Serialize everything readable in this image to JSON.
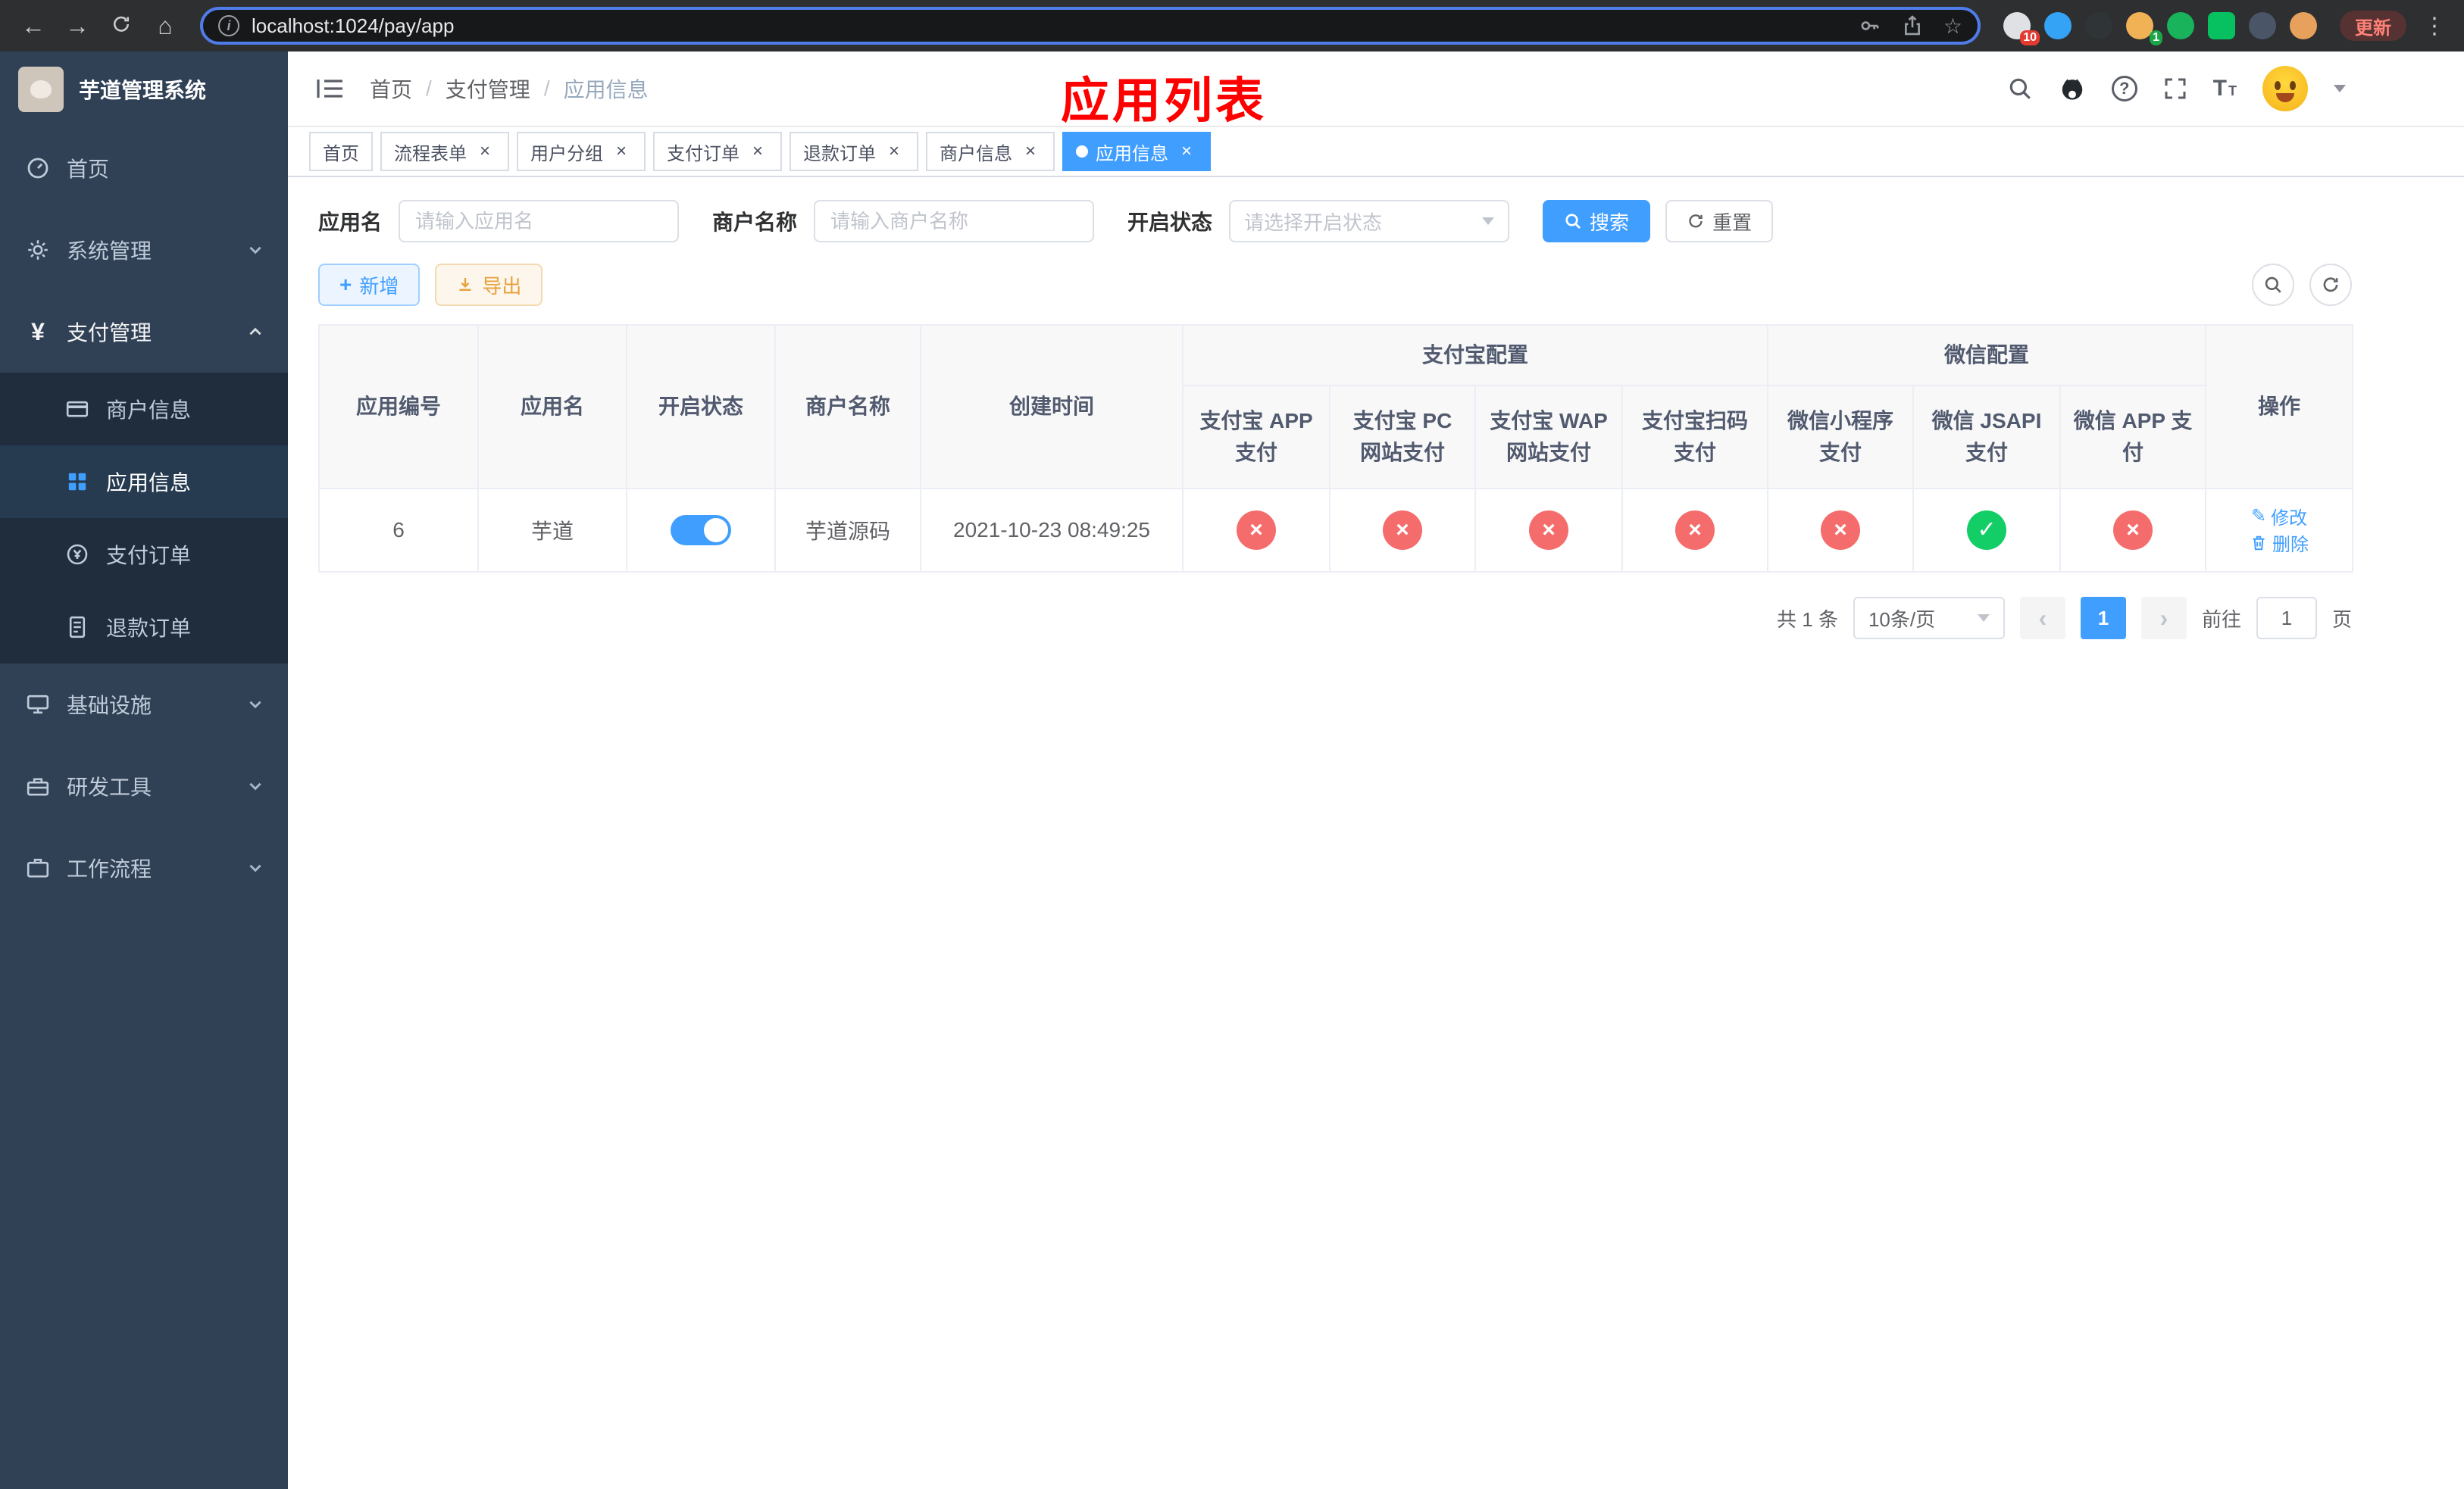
{
  "browser": {
    "url": "localhost:1024/pay/app",
    "update_label": "更新",
    "ext_badge_1": "10",
    "ext_badge_2": "1"
  },
  "icons": {
    "back": "←",
    "forward": "→",
    "home": "⌂",
    "star": "☆",
    "kebab": "⋮",
    "info": "i",
    "question": "?",
    "plus": "+",
    "close": "×",
    "check": "✓",
    "cross": "×",
    "prev": "‹",
    "next": "›",
    "yen": "¥",
    "edit_pencil": "✎",
    "font_big": "T",
    "font_small": "T"
  },
  "sidebar": {
    "app_title": "芋道管理系统",
    "menu": [
      {
        "label": "首页"
      },
      {
        "label": "系统管理",
        "expandable": true
      },
      {
        "label": "支付管理",
        "expandable": true,
        "expanded": true
      },
      {
        "label": "商户信息"
      },
      {
        "label": "应用信息",
        "active": true
      },
      {
        "label": "支付订单"
      },
      {
        "label": "退款订单"
      },
      {
        "label": "基础设施",
        "expandable": true
      },
      {
        "label": "研发工具",
        "expandable": true
      },
      {
        "label": "工作流程",
        "expandable": true
      }
    ]
  },
  "header": {
    "breadcrumb": [
      "首页",
      "支付管理",
      "应用信息"
    ],
    "annotation": "应用列表"
  },
  "tabs": [
    {
      "label": "首页",
      "closable": false,
      "active": false
    },
    {
      "label": "流程表单",
      "closable": true,
      "active": false
    },
    {
      "label": "用户分组",
      "closable": true,
      "active": false
    },
    {
      "label": "支付订单",
      "closable": true,
      "active": false
    },
    {
      "label": "退款订单",
      "closable": true,
      "active": false
    },
    {
      "label": "商户信息",
      "closable": true,
      "active": false
    },
    {
      "label": "应用信息",
      "closable": true,
      "active": true
    }
  ],
  "filters": {
    "app_name_label": "应用名",
    "app_name_placeholder": "请输入应用名",
    "merchant_label": "商户名称",
    "merchant_placeholder": "请输入商户名称",
    "status_label": "开启状态",
    "status_placeholder": "请选择开启状态",
    "search_button": "搜索",
    "reset_button": "重置"
  },
  "toolbar": {
    "add_button": "新增",
    "export_button": "导出"
  },
  "table": {
    "groups": {
      "alipay": "支付宝配置",
      "wechat": "微信配置"
    },
    "columns": {
      "app_id": "应用编号",
      "app_name": "应用名",
      "status": "开启状态",
      "merchant": "商户名称",
      "created": "创建时间",
      "alipay_app": "支付宝 APP 支付",
      "alipay_pc": "支付宝 PC 网站支付",
      "alipay_wap": "支付宝 WAP 网站支付",
      "alipay_qr": "支付宝扫码支付",
      "wx_mini": "微信小程序支付",
      "wx_jsapi": "微信 JSAPI 支付",
      "wx_app": "微信 APP 支付",
      "actions": "操作"
    },
    "rows": [
      {
        "app_id": "6",
        "app_name": "芋道",
        "status_enabled": true,
        "merchant": "芋道源码",
        "created": "2021-10-23 08:49:25",
        "configs": {
          "alipay_app": false,
          "alipay_pc": false,
          "alipay_wap": false,
          "alipay_qr": false,
          "wx_mini": false,
          "wx_jsapi": true,
          "wx_app": false
        },
        "edit_label": "修改",
        "delete_label": "删除"
      }
    ]
  },
  "pagination": {
    "total_text": "共 1 条",
    "page_size": "10条/页",
    "current_page": "1",
    "goto_prefix": "前往",
    "goto_value": "1",
    "goto_suffix": "页"
  },
  "colors": {
    "accent": "#409eff",
    "success": "#13ce66",
    "danger": "#f56c6c",
    "warning": "#e6a23c",
    "sidebar_bg": "#304156",
    "submenu_bg": "#1f2d3d",
    "annotation": "#ff0000"
  }
}
